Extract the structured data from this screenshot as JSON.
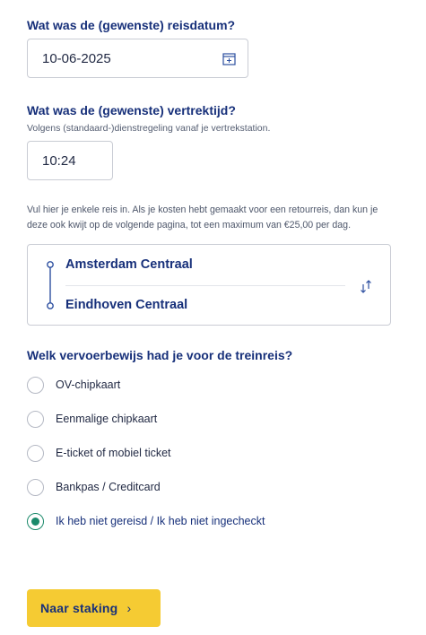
{
  "date": {
    "question": "Wat was de (gewenste) reisdatum?",
    "value": "10-06-2025",
    "icon": "calendar-icon"
  },
  "time": {
    "question": "Wat was de (gewenste) vertrektijd?",
    "hint": "Volgens (standaard-)dienstregeling vanaf je vertrekstation.",
    "value": "10:24"
  },
  "info_text": "Vul hier je enkele reis in. Als je kosten hebt gemaakt voor een retourreis, dan kun je deze ook kwijt op de volgende pagina, tot een maximum van €25,00 per dag.",
  "route": {
    "from": "Amsterdam Centraal",
    "to": "Eindhoven Centraal",
    "swap_icon": "swap-arrows-icon"
  },
  "ticket": {
    "question": "Welk vervoerbewijs had je voor de treinreis?",
    "options": [
      {
        "label": "OV-chipkaart",
        "checked": false
      },
      {
        "label": "Eenmalige chipkaart",
        "checked": false
      },
      {
        "label": "E-ticket of mobiel ticket",
        "checked": false
      },
      {
        "label": "Bankpas / Creditcard",
        "checked": false
      },
      {
        "label": "Ik heb niet gereisd / Ik heb niet ingecheckt",
        "checked": true
      }
    ]
  },
  "cta": {
    "label": "Naar staking",
    "chevron": "›"
  },
  "colors": {
    "primary": "#17307a",
    "accent_yellow": "#f5cb33",
    "radio_green": "#1b8a6b",
    "border": "#c9ccd4"
  }
}
